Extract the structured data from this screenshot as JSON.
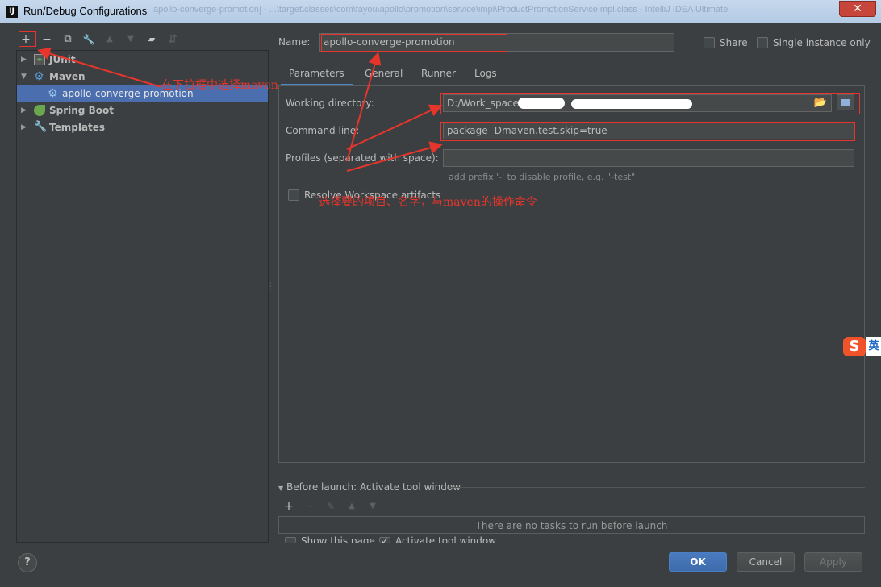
{
  "window": {
    "app_icon": "IJ",
    "title": "Run/Debug Configurations",
    "close_glyph": "✕",
    "background_title": "apollo-converge-promotion] - ...\\target\\classes\\com\\fayou\\apollo\\promotion\\service\\impl\\ProductPromotionServiceImpl.class - IntelliJ IDEA Ultimate"
  },
  "toolbar": {
    "add": "+",
    "remove": "−",
    "copy": "⧉",
    "edit": "🔧",
    "move_up": "▲",
    "move_down": "▼",
    "new_folder": "▰",
    "sort": "⇵"
  },
  "tree": [
    {
      "label": "JUnit",
      "icon": "junit-icon",
      "expanded": false
    },
    {
      "label": "Maven",
      "icon": "maven-icon",
      "expanded": true
    },
    {
      "label": "apollo-converge-promotion",
      "icon": "maven-config-icon",
      "selected": true
    },
    {
      "label": "Spring Boot",
      "icon": "spring-boot-icon",
      "expanded": false
    },
    {
      "label": "Templates",
      "icon": "wrench-icon",
      "expanded": false
    }
  ],
  "form": {
    "name_label": "Name:",
    "name_value": "apollo-converge-promotion",
    "share_label": "Share",
    "single_instance_label": "Single instance only",
    "tabs": [
      "Parameters",
      "General",
      "Runner",
      "Logs"
    ],
    "working_dir_label": "Working directory:",
    "working_dir_value": "D:/Work_space",
    "command_line_label": "Command line:",
    "command_line_value": "package -Dmaven.test.skip=true",
    "profiles_label": "Profiles (separated with space):",
    "profiles_value": "",
    "profiles_hint": "add prefix '-' to disable profile, e.g. \"-test\"",
    "resolve_label": "Resolve Workspace artifacts"
  },
  "before_launch": {
    "label": "Before launch: Activate tool window",
    "empty_text": "There are no tasks to run before launch",
    "show_page_label": "Show this page",
    "activate_label": "Activate tool window"
  },
  "buttons": {
    "help": "?",
    "ok": "OK",
    "cancel": "Cancel",
    "apply": "Apply"
  },
  "annotations": {
    "note_dropdown": "在下拉框中选择maven",
    "note_project": "选择要的项目、名字，与maven的操作命令",
    "color": "#e8352c"
  },
  "ime": {
    "logo": "S",
    "label": "英"
  },
  "colors": {
    "background": "#3c3f41",
    "selection": "#4b6eaf",
    "primary_button": "#4a7bbf"
  }
}
